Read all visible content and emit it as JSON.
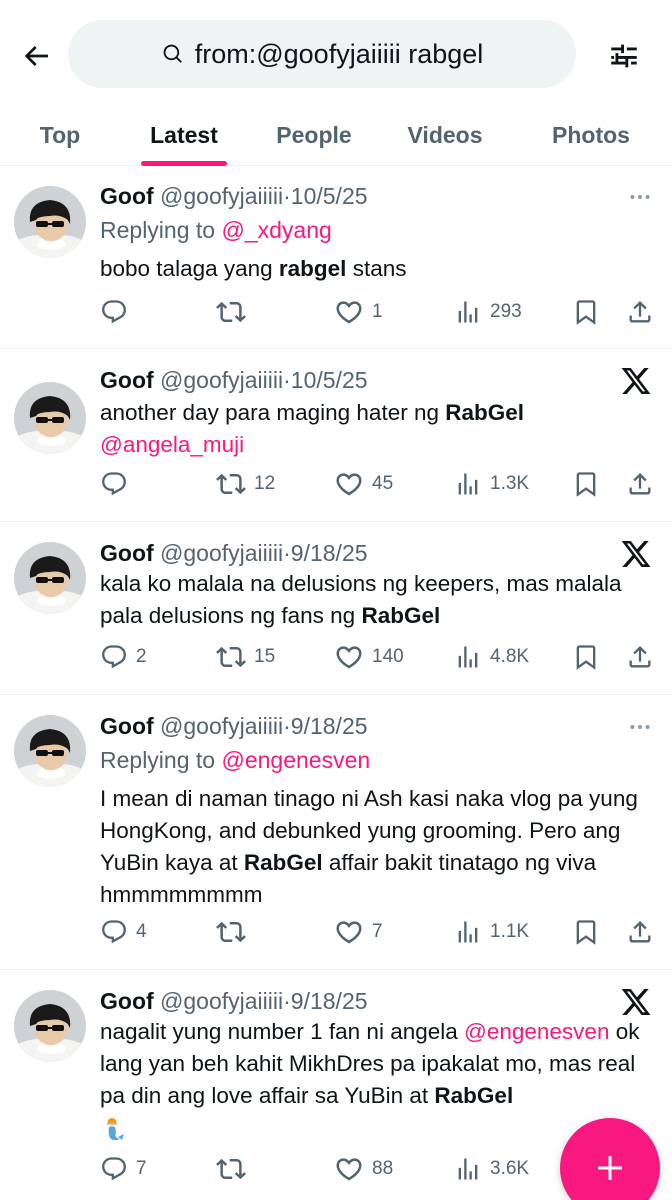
{
  "search": {
    "query": "from:@goofyjaiiiii rabgel"
  },
  "tabs": [
    {
      "label": "Top",
      "active": false
    },
    {
      "label": "Latest",
      "active": true
    },
    {
      "label": "People",
      "active": false
    },
    {
      "label": "Videos",
      "active": false
    },
    {
      "label": "Photos",
      "active": false
    }
  ],
  "accent_color": "#f91880",
  "tweets": [
    {
      "name": "Goof",
      "handle": "@goofyjaiiiii",
      "dot": "·",
      "date": "10/5/25",
      "replying_prefix": "Replying to",
      "replying_to": "@_xdyang",
      "text_a": "bobo talaga yang ",
      "text_bold": "rabgel",
      "text_b": " stans",
      "replies": "",
      "retweets": "",
      "likes": "1",
      "views": "293",
      "corner_icon": "more-icon"
    },
    {
      "name": "Goof",
      "handle": "@goofyjaiiiii",
      "dot": "·",
      "date": "10/5/25",
      "text_a": "another day para maging hater ng ",
      "text_bold": "RabGel",
      "text_mention": "@angela_muji",
      "replies": "",
      "retweets": "12",
      "likes": "45",
      "views": "1.3K",
      "corner_icon": "x-logo-icon"
    },
    {
      "name": "Goof",
      "handle": "@goofyjaiiiii",
      "dot": "·",
      "date": "9/18/25",
      "text_a": "kala ko malala na delusions ng keepers, mas malala pala delusions ng fans ng ",
      "text_bold": "RabGel",
      "replies": "2",
      "retweets": "15",
      "likes": "140",
      "views": "4.8K",
      "corner_icon": "x-logo-icon"
    },
    {
      "name": "Goof",
      "handle": "@goofyjaiiiii",
      "dot": "·",
      "date": "9/18/25",
      "replying_prefix": "Replying to",
      "replying_to": "@engenesven",
      "text_a": "I mean di naman tinago ni Ash kasi naka vlog pa yung HongKong, and debunked yung grooming. Pero ang YuBin kaya at ",
      "text_bold": "RabGel",
      "text_b": " affair bakit tinatago ng viva hmmmmmmmm",
      "replies": "4",
      "retweets": "",
      "likes": "7",
      "views": "1.1K",
      "corner_icon": "more-icon"
    },
    {
      "name": "Goof",
      "handle": "@goofyjaiiiii",
      "dot": "·",
      "date": "9/18/25",
      "text_a": "nagalit yung number 1 fan ni angela ",
      "text_mention": "@engenesven",
      "text_b": " ok lang yan beh kahit MikhDres pa ipakalat mo, mas real pa din ang love affair sa YuBin at ",
      "text_bold": "RabGel",
      "replies": "7",
      "retweets": "",
      "likes": "88",
      "views": "3.6K",
      "corner_icon": "x-logo-icon"
    }
  ]
}
